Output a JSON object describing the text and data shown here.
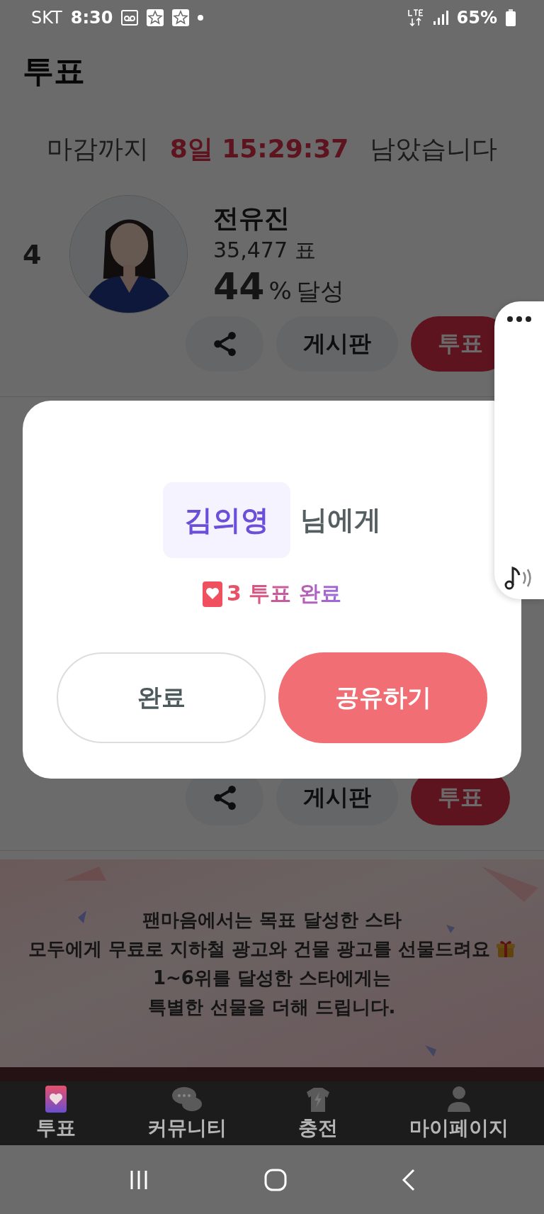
{
  "status_bar": {
    "carrier": "SKT",
    "time": "8:30",
    "battery": "65%"
  },
  "header": {
    "title": "투표"
  },
  "deadline": {
    "prefix": "마감까지",
    "remaining": "8일 15:29:37",
    "suffix": "남았습니다"
  },
  "candidates": [
    {
      "rank": "4",
      "name": "전유진",
      "votes": "35,477 표",
      "percent": "44",
      "percent_unit": "%",
      "percent_label": "달성",
      "actions": [
        {
          "kind": "share"
        },
        {
          "kind": "board",
          "label": "게시판"
        },
        {
          "kind": "vote",
          "label": "투표"
        }
      ]
    },
    {
      "actions": [
        {
          "kind": "share"
        },
        {
          "kind": "board",
          "label": "게시판"
        },
        {
          "kind": "vote",
          "label": "투표"
        }
      ]
    }
  ],
  "banner": {
    "lines": [
      "팬마음에서는 목표 달성한 스타",
      "모두에게 무료로 지하철 광고와 건물 광고를 선물드려요",
      "1~6위를 달성한 스타에게는",
      "특별한 선물을 더해 드립니다."
    ]
  },
  "dialog": {
    "recipient": "김의영",
    "recipient_suffix": "님에게",
    "result": "3 투표 완료",
    "buttons": [
      {
        "kind": "secondary",
        "label": "완료"
      },
      {
        "kind": "primary",
        "label": "공유하기"
      }
    ]
  },
  "bottom_nav": [
    {
      "kind": "vote",
      "label": "투표",
      "selected": true
    },
    {
      "kind": "community",
      "label": "커뮤니티",
      "selected": false
    },
    {
      "kind": "charge",
      "label": "충전",
      "selected": false
    },
    {
      "kind": "mypage",
      "label": "마이페이지",
      "selected": false
    }
  ]
}
